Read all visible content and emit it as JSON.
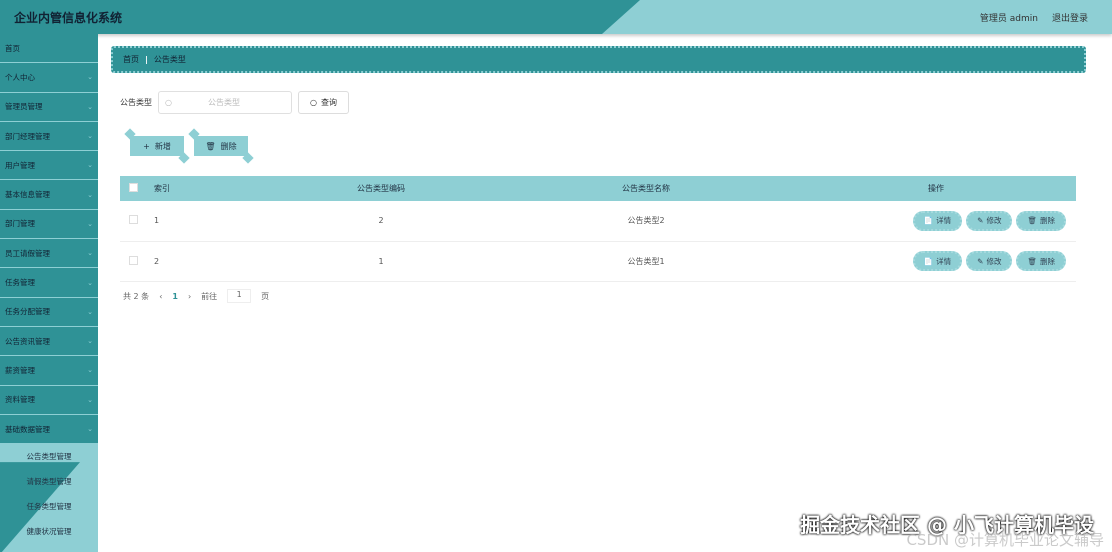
{
  "header": {
    "title": "企业内管信息化系统",
    "user": "管理员 admin",
    "logout": "退出登录"
  },
  "sidebar": {
    "items": [
      "首页",
      "个人中心",
      "管理员管理",
      "部门经理管理",
      "用户管理",
      "基本信息管理",
      "部门管理",
      "员工请假管理",
      "任务管理",
      "任务分配管理",
      "公告资讯管理",
      "薪资管理",
      "资料管理",
      "基础数据管理"
    ],
    "sub_items": [
      "公告类型管理",
      "请假类型管理",
      "任务类型管理",
      "健康状况管理"
    ]
  },
  "breadcrumb": {
    "home": "首页",
    "current": "公告类型"
  },
  "search": {
    "label": "公告类型",
    "placeholder": "公告类型",
    "button": "查询"
  },
  "actions": {
    "add": "新增",
    "delete": "删除"
  },
  "table": {
    "headers": [
      "索引",
      "公告类型编码",
      "公告类型名称",
      "操作"
    ],
    "rows": [
      {
        "index": "1",
        "code": "2",
        "name": "公告类型2"
      },
      {
        "index": "2",
        "code": "1",
        "name": "公告类型1"
      }
    ],
    "row_actions": [
      "详情",
      "修改",
      "删除"
    ]
  },
  "pager": {
    "total": "共 2 条",
    "page": "1",
    "goto": "前往",
    "goto_value": "1",
    "page_unit": "页"
  },
  "watermark": {
    "line1": "掘金技术社区 @ 小飞计算机毕设",
    "line2": "CSDN @计算机毕业论文辅导"
  }
}
